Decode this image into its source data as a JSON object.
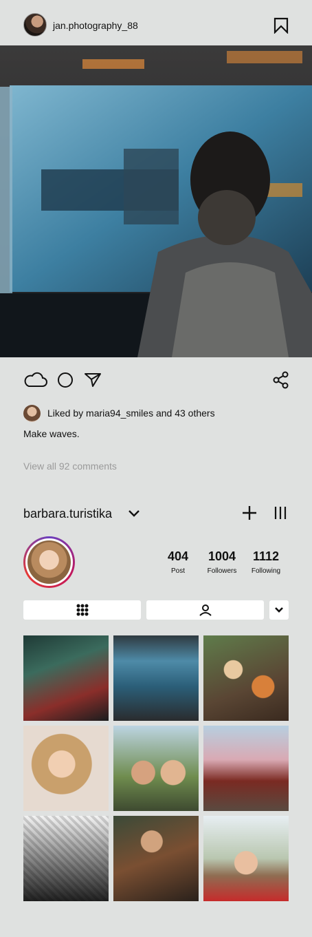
{
  "post": {
    "username": "jan.photography_88",
    "liked_text": "Liked by maria94_smiles and 43 others",
    "caption": "Make waves.",
    "view_comments": "View all 92 comments"
  },
  "profile": {
    "username": "barbara.turistika",
    "stats": [
      {
        "value": "404",
        "label": "Post"
      },
      {
        "value": "1004",
        "label": "Followers"
      },
      {
        "value": "1112",
        "label": "Following"
      }
    ]
  },
  "icons": {
    "bookmark": "bookmark-icon",
    "like": "cloud-icon",
    "comment": "circle-icon",
    "send": "send-icon",
    "share": "share-icon",
    "chevron": "chevron-down-icon",
    "add": "plus-icon",
    "menu": "menu-icon",
    "grid": "grid-icon",
    "tagged": "person-icon"
  },
  "colors": {
    "background": "#dfe1e0",
    "story_ring_start": "#6a3fbf",
    "story_ring_end": "#e53935"
  }
}
